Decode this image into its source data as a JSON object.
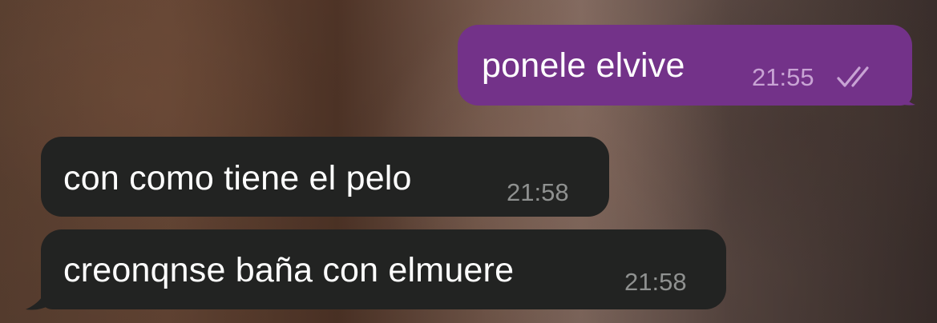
{
  "messages": [
    {
      "direction": "outgoing",
      "text": "ponele elvive",
      "time": "21:55",
      "status_icon": "double-check-read-icon"
    },
    {
      "direction": "incoming",
      "text": "con como tiene el pelo",
      "time": "21:58"
    },
    {
      "direction": "incoming",
      "text": "creonqnse baña con elmuere",
      "time": "21:58"
    }
  ],
  "colors": {
    "outgoing_bubble": "#733289",
    "incoming_bubble": "#222322",
    "outgoing_time": "#c8a3d4",
    "incoming_time": "#8f9190",
    "message_text": "#ffffff"
  }
}
